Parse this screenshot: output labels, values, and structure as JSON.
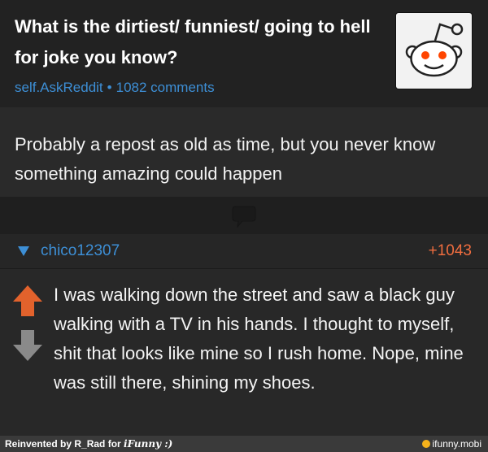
{
  "post": {
    "title": "What is the dirtiest/ funniest/ going to hell for joke you know?",
    "subreddit": "self.AskReddit",
    "separator": "•",
    "comments": "1082 comments",
    "thumbnail_icon": "reddit-alien-icon",
    "selftext": "Probably a repost as old as time, but you never know something amazing could happen"
  },
  "divider": {
    "icon": "comment-bubble-icon"
  },
  "comment": {
    "collapse_icon": "triangle-down-icon",
    "author": "chico12307",
    "score": "+1043",
    "upvote_icon": "arrow-up-icon",
    "downvote_icon": "arrow-down-icon",
    "body": "I was walking down the street and saw a black guy walking with a TV in his hands. I thought to myself, shit that looks like mine so I rush home. Nope, mine was still there, shining my shoes."
  },
  "footer": {
    "left_prefix": "Reinvented by R_Rad for ",
    "left_brand": "iFunny :)",
    "right": "ifunny.mobi"
  },
  "colors": {
    "link_blue": "#3d8fd6",
    "score_orange": "#f06d3f",
    "upvote_orange": "#e2622c",
    "downvote_gray": "#8a8a8a"
  }
}
